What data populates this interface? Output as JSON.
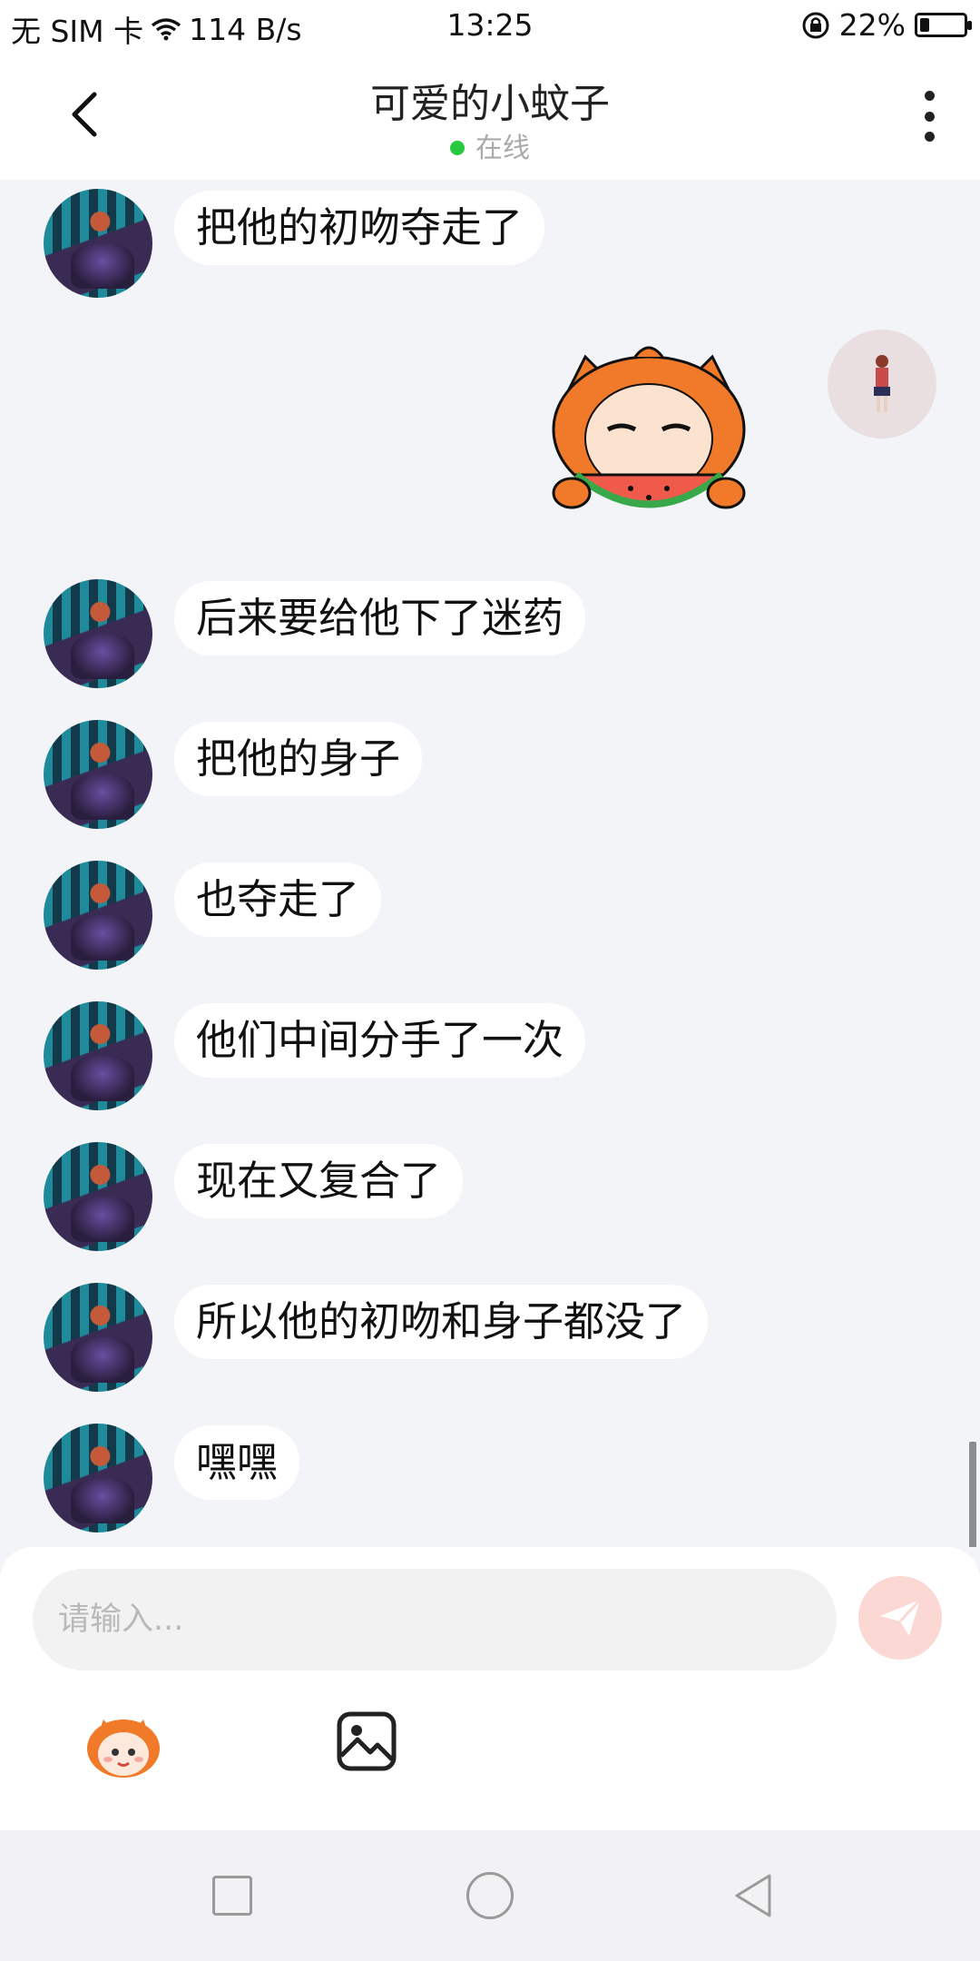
{
  "status_bar": {
    "carrier": "无 SIM 卡",
    "net_speed": "114 B/s",
    "time": "13:25",
    "battery_percent_text": "22%",
    "battery_level": 0.22
  },
  "header": {
    "title": "可爱的小蚊子",
    "status": "在线",
    "status_color": "#27c93f"
  },
  "messages": [
    {
      "from": "other",
      "text": "把他的初吻夺走了"
    },
    {
      "from": "self",
      "type": "sticker",
      "sticker": "watermelon-eating-mascot"
    },
    {
      "from": "other",
      "text": "后来要给他下了迷药"
    },
    {
      "from": "other",
      "text": "把他的身子"
    },
    {
      "from": "other",
      "text": "也夺走了"
    },
    {
      "from": "other",
      "text": "他们中间分手了一次"
    },
    {
      "from": "other",
      "text": "现在又复合了"
    },
    {
      "from": "other",
      "text": "所以他的初吻和身子都没了"
    },
    {
      "from": "other",
      "text": "嘿嘿"
    }
  ],
  "input": {
    "placeholder": "请输入..."
  },
  "toolbar": {
    "emoji_icon": "mascot-emoji-icon",
    "image_icon": "image-icon",
    "send_icon": "paper-plane-icon"
  },
  "colors": {
    "bubble_bg": "#ffffff",
    "chat_bg": "#f3f4f7",
    "mascot_orange": "#f07a2a"
  }
}
